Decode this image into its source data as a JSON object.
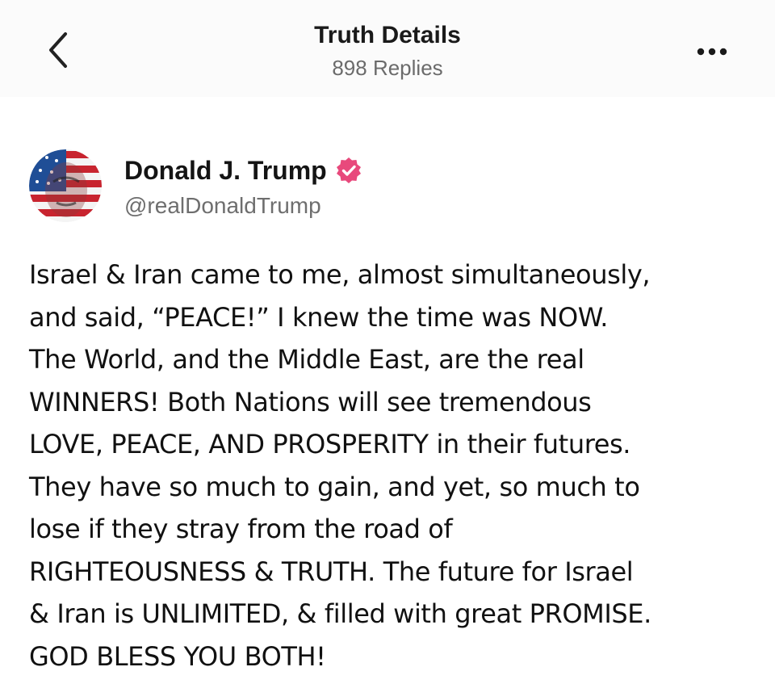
{
  "header": {
    "title": "Truth Details",
    "replies": "898 Replies",
    "back_icon": "chevron-left-icon",
    "more_icon": "more-horizontal-icon"
  },
  "author": {
    "name": "Donald J. Trump",
    "handle": "@realDonaldTrump",
    "verified_color": "#e8497c"
  },
  "post": {
    "lines": [
      "Israel & Iran came to me, almost simultaneously,",
      "and said, “PEACE!” I knew the time was NOW.",
      "The World, and the Middle East, are the real",
      "WINNERS! Both Nations will see tremendous",
      "LOVE, PEACE, AND PROSPERITY in their futures.",
      "They have so much to gain, and yet, so much to",
      "lose if they stray from the road of",
      "RIGHTEOUSNESS & TRUTH. The future for Israel",
      "& Iran is UNLIMITED, & filled with great PROMISE.",
      "GOD BLESS YOU BOTH!"
    ]
  }
}
